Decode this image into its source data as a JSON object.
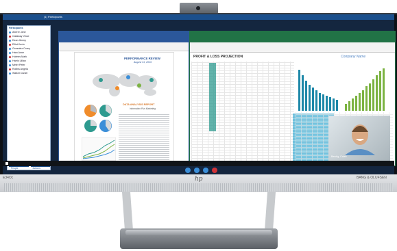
{
  "monitor": {
    "logo": "hp",
    "model_label": "E34Oc",
    "brand_label": "BANG & OLUFSEN"
  },
  "meeting": {
    "window_title": "(1) Participants",
    "participants_heading": "Participants",
    "participants": [
      {
        "name": "Aberer Jane",
        "color": "#3b8ed8"
      },
      {
        "name": "Callaway Vince",
        "color": "#d13438"
      },
      {
        "name": "Dean Jimmy",
        "color": "#3b8ed8"
      },
      {
        "name": "Elliot Kevin",
        "color": "#d13438"
      },
      {
        "name": "Gonzalez Corey",
        "color": "#3b8ed8"
      },
      {
        "name": "Haro Anne",
        "color": "#3b8ed8"
      },
      {
        "name": "Holmes Mark",
        "color": "#d13438"
      },
      {
        "name": "Harris Lillian",
        "color": "#3b8ed8"
      },
      {
        "name": "Meier Peter",
        "color": "#3b8ed8"
      },
      {
        "name": "Rollins Angela",
        "color": "#d13438"
      },
      {
        "name": "Walker Daniel",
        "color": "#3b8ed8"
      }
    ],
    "buttons": [
      "Invite More People",
      "Participant Actions"
    ],
    "video_caption": "Bendig, Caleb"
  },
  "word_doc": {
    "heading": "PERFORMANCE REVIEW",
    "subheading": "August 31, 2016",
    "section": "DATA ANALYSIS REPORT",
    "section_sub": "Information Plus Marketing"
  },
  "excel": {
    "title": "PROFIT & LOSS PROJECTION",
    "company": "Company Name"
  },
  "colors": {
    "word": "#2b579a",
    "excel": "#217346",
    "accent": "#1b4f8c",
    "bar_green": "#7cb342",
    "bar_teal": "#1e88a8"
  }
}
